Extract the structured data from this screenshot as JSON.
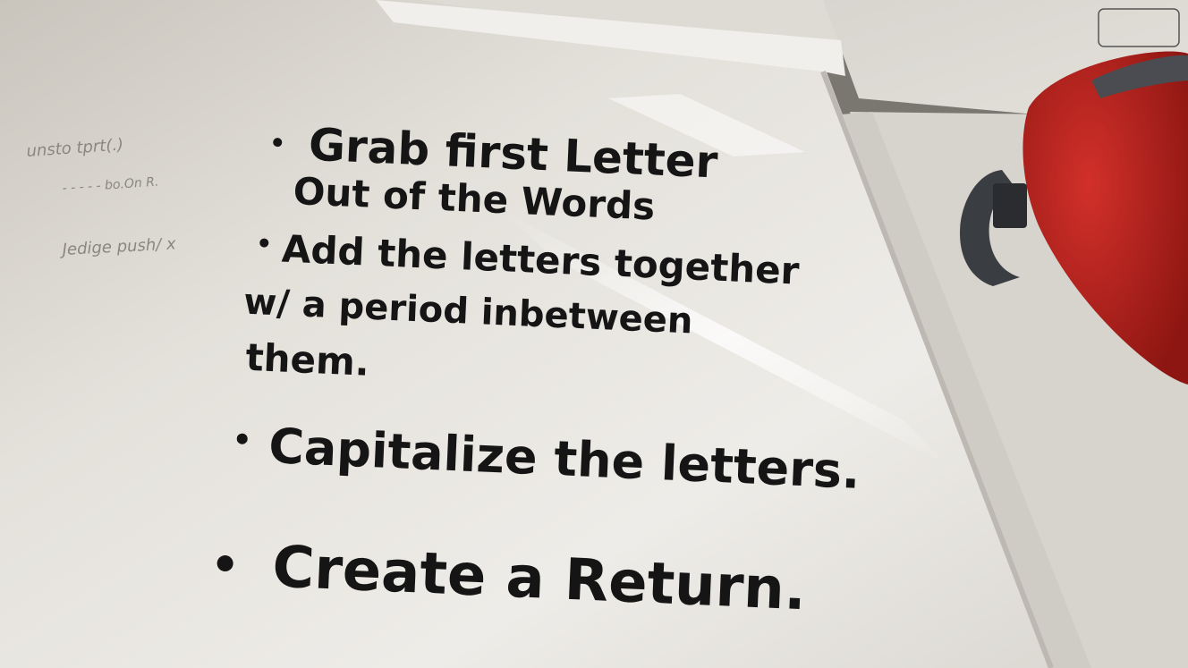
{
  "whiteboard": {
    "steps": [
      {
        "lines": [
          "Grab first Letter",
          "Out of the Words"
        ]
      },
      {
        "lines": [
          "Add the letters together",
          "w/ a period inbetween",
          "them."
        ]
      },
      {
        "lines": [
          "Capitalize the letters."
        ]
      },
      {
        "lines": [
          "Create a Return."
        ]
      }
    ],
    "ink_color": "#151515",
    "board_color": "#e9e7e2"
  },
  "backpack": {
    "color": "#b3201b"
  }
}
